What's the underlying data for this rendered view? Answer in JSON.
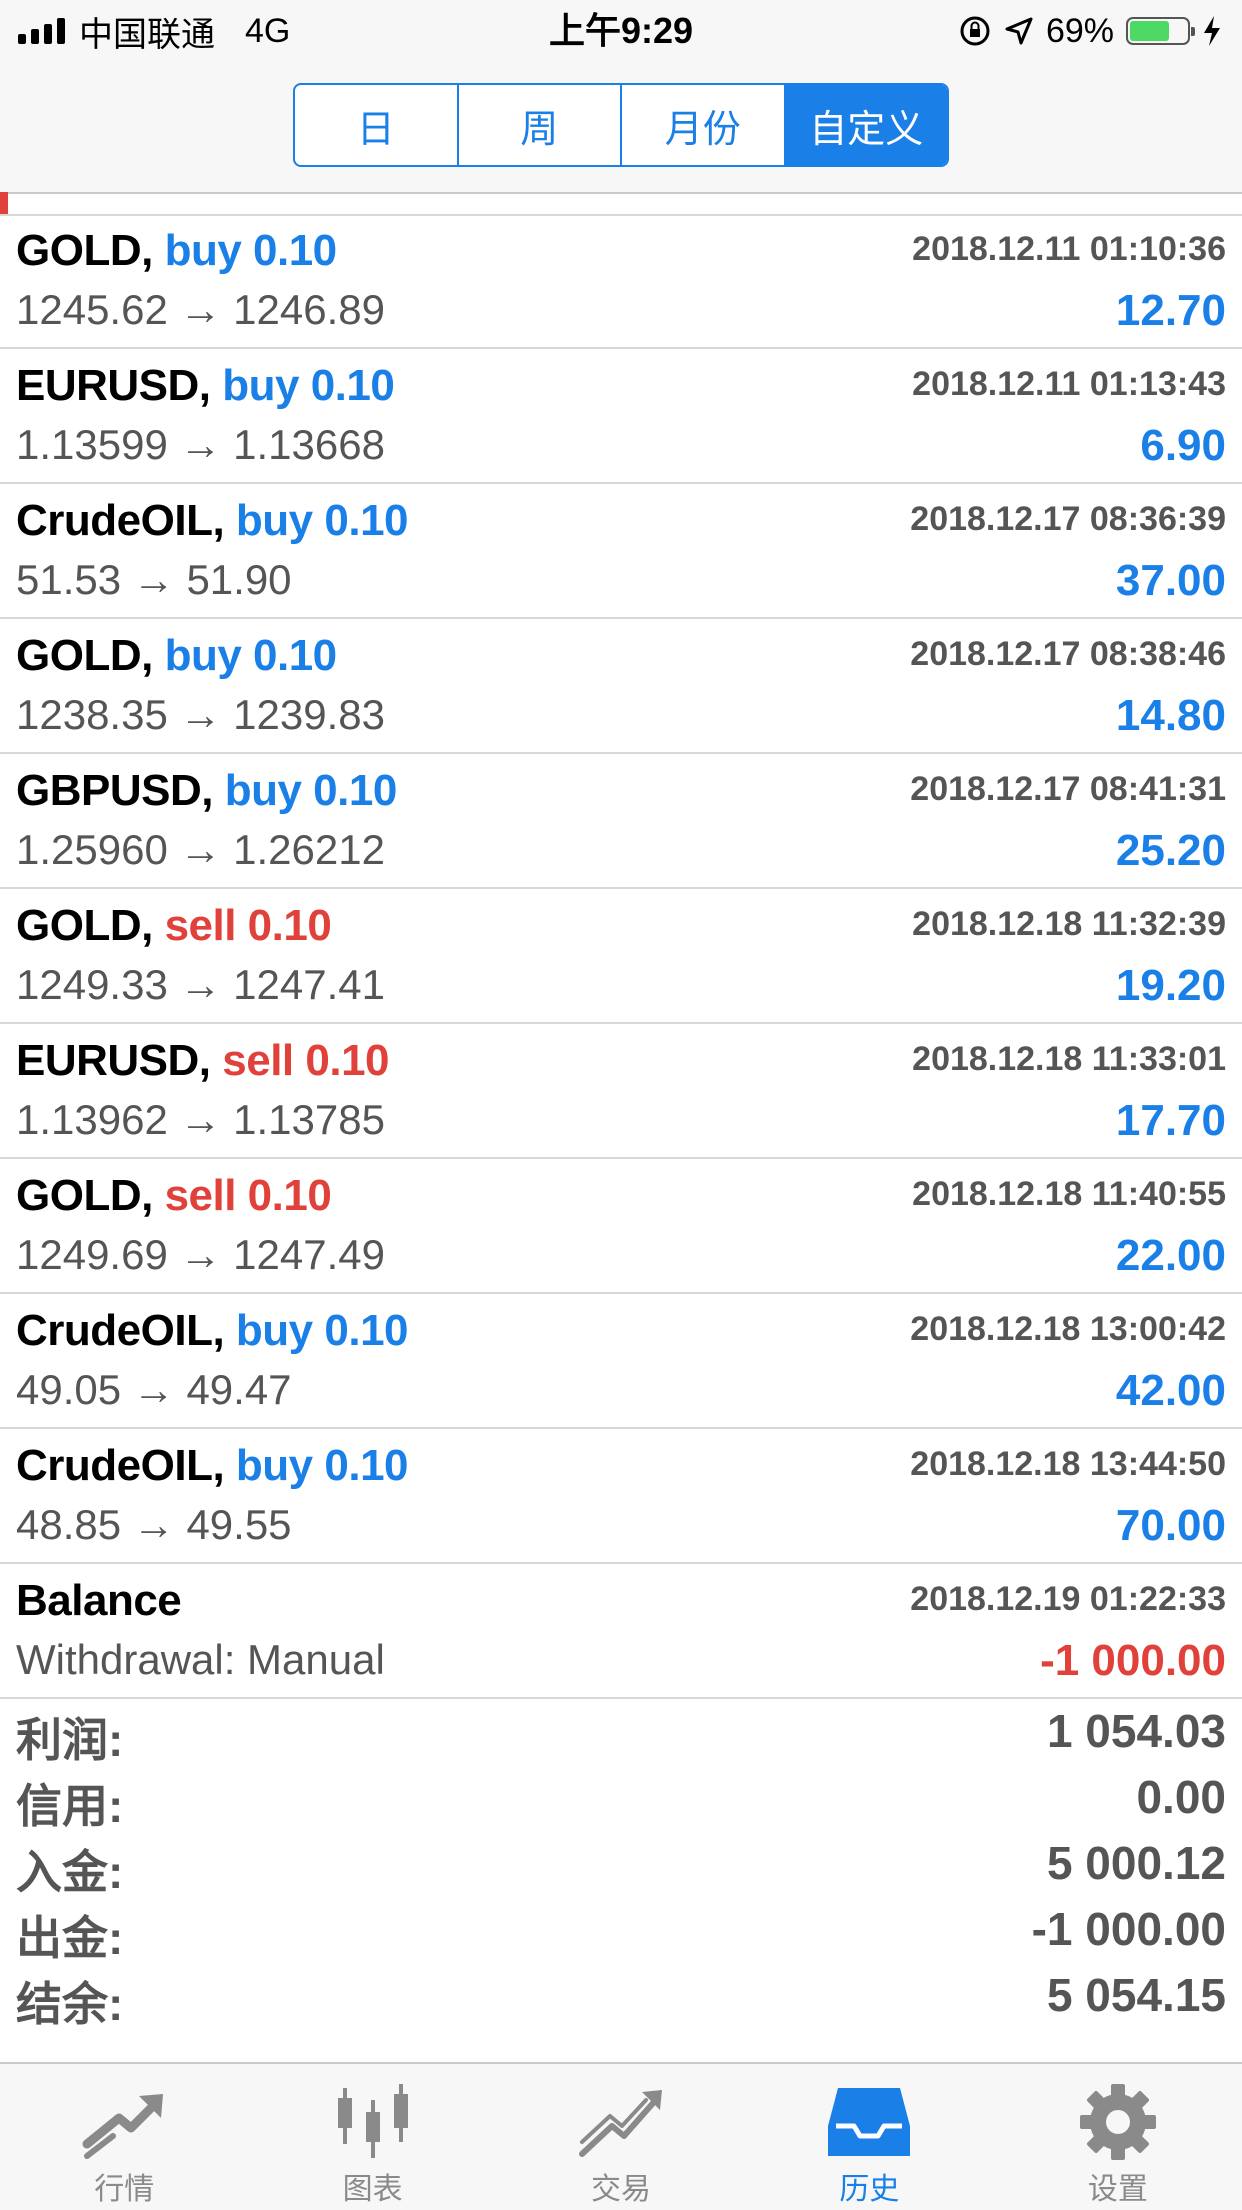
{
  "status_bar": {
    "carrier": "中国联通",
    "network": "4G",
    "time": "上午9:29",
    "battery": "69%",
    "battery_level": 0.69
  },
  "segments": [
    {
      "label": "日",
      "active": false
    },
    {
      "label": "周",
      "active": false
    },
    {
      "label": "月份",
      "active": false
    },
    {
      "label": "自定义",
      "active": true
    }
  ],
  "deals": [
    {
      "symbol": "GOLD,",
      "side": "buy 0.10",
      "side_type": "buy",
      "time": "2018.12.11 01:10:36",
      "price": "1245.62 → 1246.89",
      "profit": "12.70",
      "profit_sign": "pos"
    },
    {
      "symbol": "EURUSD,",
      "side": "buy 0.10",
      "side_type": "buy",
      "time": "2018.12.11 01:13:43",
      "price": "1.13599 → 1.13668",
      "profit": "6.90",
      "profit_sign": "pos"
    },
    {
      "symbol": "CrudeOIL,",
      "side": "buy 0.10",
      "side_type": "buy",
      "time": "2018.12.17 08:36:39",
      "price": "51.53 → 51.90",
      "profit": "37.00",
      "profit_sign": "pos"
    },
    {
      "symbol": "GOLD,",
      "side": "buy 0.10",
      "side_type": "buy",
      "time": "2018.12.17 08:38:46",
      "price": "1238.35 → 1239.83",
      "profit": "14.80",
      "profit_sign": "pos"
    },
    {
      "symbol": "GBPUSD,",
      "side": "buy 0.10",
      "side_type": "buy",
      "time": "2018.12.17 08:41:31",
      "price": "1.25960 → 1.26212",
      "profit": "25.20",
      "profit_sign": "pos"
    },
    {
      "symbol": "GOLD,",
      "side": "sell 0.10",
      "side_type": "sell",
      "time": "2018.12.18 11:32:39",
      "price": "1249.33 → 1247.41",
      "profit": "19.20",
      "profit_sign": "pos"
    },
    {
      "symbol": "EURUSD,",
      "side": "sell 0.10",
      "side_type": "sell",
      "time": "2018.12.18 11:33:01",
      "price": "1.13962 → 1.13785",
      "profit": "17.70",
      "profit_sign": "pos"
    },
    {
      "symbol": "GOLD,",
      "side": "sell 0.10",
      "side_type": "sell",
      "time": "2018.12.18 11:40:55",
      "price": "1249.69 → 1247.49",
      "profit": "22.00",
      "profit_sign": "pos"
    },
    {
      "symbol": "CrudeOIL,",
      "side": "buy 0.10",
      "side_type": "buy",
      "time": "2018.12.18 13:00:42",
      "price": "49.05 → 49.47",
      "profit": "42.00",
      "profit_sign": "pos"
    },
    {
      "symbol": "CrudeOIL,",
      "side": "buy 0.10",
      "side_type": "buy",
      "time": "2018.12.18 13:44:50",
      "price": "48.85 → 49.55",
      "profit": "70.00",
      "profit_sign": "pos"
    },
    {
      "symbol": "Balance",
      "side": "",
      "side_type": "",
      "time": "2018.12.19 01:22:33",
      "price": "Withdrawal: Manual",
      "profit": "-1 000.00",
      "profit_sign": "neg"
    }
  ],
  "summary": [
    {
      "label": "利润:",
      "value": "1 054.03"
    },
    {
      "label": "信用:",
      "value": "0.00"
    },
    {
      "label": "入金:",
      "value": "5 000.12"
    },
    {
      "label": "出金:",
      "value": "-1 000.00"
    },
    {
      "label": "结余:",
      "value": "5 054.15"
    }
  ],
  "tabs": [
    {
      "label": "行情",
      "icon": "quotes-arrows-icon",
      "active": false
    },
    {
      "label": "图表",
      "icon": "candlestick-chart-icon",
      "active": false
    },
    {
      "label": "交易",
      "icon": "trade-trend-icon",
      "active": false
    },
    {
      "label": "历史",
      "icon": "history-inbox-icon",
      "active": true
    },
    {
      "label": "设置",
      "icon": "gear-icon",
      "active": false
    }
  ],
  "colors": {
    "accent": "#1a7fe6",
    "sell": "#e0413a",
    "text_gray": "#555555",
    "tab_inactive": "#8a8a8a"
  }
}
